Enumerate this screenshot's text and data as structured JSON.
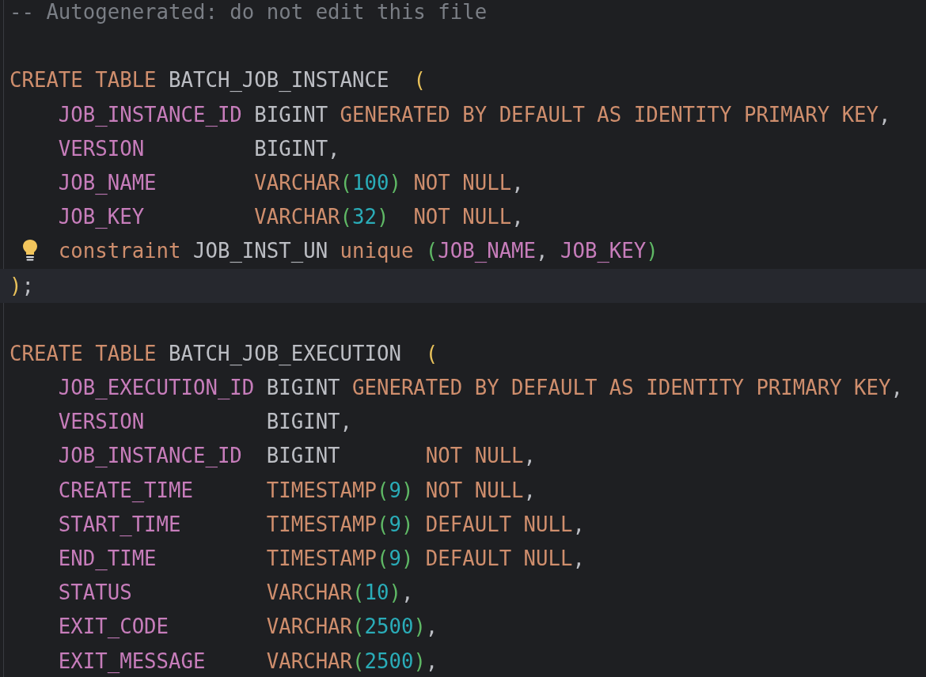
{
  "editor": {
    "lines": [
      {
        "kind": "code",
        "current": false,
        "bulb": false,
        "tokens": [
          {
            "text": "-- Autogenerated: do not edit this file",
            "kind": "comment"
          }
        ]
      },
      {
        "kind": "blank",
        "current": false,
        "bulb": false
      },
      {
        "kind": "code",
        "current": false,
        "bulb": false,
        "tokens": [
          {
            "text": "CREATE TABLE ",
            "kind": "keyword"
          },
          {
            "text": "BATCH_JOB_INSTANCE  ",
            "kind": "plain"
          },
          {
            "text": "(",
            "kind": "paren"
          }
        ],
        "children": [
          {
            "kind": "code",
            "current": false,
            "bulb": false,
            "tokens": [
              {
                "text": "JOB_INSTANCE_ID ",
                "kind": "column"
              },
              {
                "text": "BIGINT ",
                "kind": "plain"
              },
              {
                "text": "GENERATED BY DEFAULT AS IDENTITY PRIMARY KEY",
                "kind": "keyword"
              },
              {
                "text": ",",
                "kind": "plain"
              }
            ]
          },
          {
            "kind": "code",
            "current": false,
            "bulb": false,
            "tokens": [
              {
                "text": "VERSION         ",
                "kind": "column"
              },
              {
                "text": "BIGINT,",
                "kind": "plain"
              }
            ]
          },
          {
            "kind": "code",
            "current": false,
            "bulb": false,
            "tokens": [
              {
                "text": "JOB_NAME        ",
                "kind": "column"
              },
              {
                "text": "VARCHAR",
                "kind": "keyword"
              },
              {
                "text": "(",
                "kind": "inner-paren"
              },
              {
                "text": "100",
                "kind": "number"
              },
              {
                "text": ") ",
                "kind": "inner-paren"
              },
              {
                "text": "NOT NULL",
                "kind": "keyword"
              },
              {
                "text": ",",
                "kind": "plain"
              }
            ]
          },
          {
            "kind": "code",
            "current": false,
            "bulb": false,
            "tokens": [
              {
                "text": "JOB_KEY         ",
                "kind": "column"
              },
              {
                "text": "VARCHAR",
                "kind": "keyword"
              },
              {
                "text": "(",
                "kind": "inner-paren"
              },
              {
                "text": "32",
                "kind": "number"
              },
              {
                "text": ")  ",
                "kind": "inner-paren"
              },
              {
                "text": "NOT NULL",
                "kind": "keyword"
              },
              {
                "text": ",",
                "kind": "plain"
              }
            ]
          },
          {
            "kind": "code",
            "current": false,
            "bulb": true,
            "tokens": [
              {
                "text": "constraint ",
                "kind": "keyword"
              },
              {
                "text": "JOB_INST_UN ",
                "kind": "plain"
              },
              {
                "text": "unique ",
                "kind": "keyword"
              },
              {
                "text": "(",
                "kind": "inner-paren"
              },
              {
                "text": "JOB_NAME",
                "kind": "column"
              },
              {
                "text": ", ",
                "kind": "plain"
              },
              {
                "text": "JOB_KEY",
                "kind": "column"
              },
              {
                "text": ")",
                "kind": "inner-paren"
              }
            ]
          }
        ]
      },
      {
        "kind": "code",
        "current": true,
        "bulb": false,
        "tokens": [
          {
            "text": ")",
            "kind": "paren"
          },
          {
            "text": ";",
            "kind": "plain"
          }
        ]
      },
      {
        "kind": "blank",
        "current": false,
        "bulb": false
      },
      {
        "kind": "code",
        "current": false,
        "bulb": false,
        "tokens": [
          {
            "text": "CREATE TABLE ",
            "kind": "keyword"
          },
          {
            "text": "BATCH_JOB_EXECUTION  ",
            "kind": "plain"
          },
          {
            "text": "(",
            "kind": "paren"
          }
        ],
        "children": [
          {
            "kind": "code",
            "current": false,
            "bulb": false,
            "tokens": [
              {
                "text": "JOB_EXECUTION_ID ",
                "kind": "column"
              },
              {
                "text": "BIGINT ",
                "kind": "plain"
              },
              {
                "text": "GENERATED BY DEFAULT AS IDENTITY PRIMARY KEY",
                "kind": "keyword"
              },
              {
                "text": ",",
                "kind": "plain"
              }
            ]
          },
          {
            "kind": "code",
            "current": false,
            "bulb": false,
            "tokens": [
              {
                "text": "VERSION          ",
                "kind": "column"
              },
              {
                "text": "BIGINT,",
                "kind": "plain"
              }
            ]
          },
          {
            "kind": "code",
            "current": false,
            "bulb": false,
            "tokens": [
              {
                "text": "JOB_INSTANCE_ID  ",
                "kind": "column"
              },
              {
                "text": "BIGINT       ",
                "kind": "plain"
              },
              {
                "text": "NOT NULL",
                "kind": "keyword"
              },
              {
                "text": ",",
                "kind": "plain"
              }
            ]
          },
          {
            "kind": "code",
            "current": false,
            "bulb": false,
            "tokens": [
              {
                "text": "CREATE_TIME      ",
                "kind": "column"
              },
              {
                "text": "TIMESTAMP",
                "kind": "keyword"
              },
              {
                "text": "(",
                "kind": "inner-paren"
              },
              {
                "text": "9",
                "kind": "number"
              },
              {
                "text": ") ",
                "kind": "inner-paren"
              },
              {
                "text": "NOT NULL",
                "kind": "keyword"
              },
              {
                "text": ",",
                "kind": "plain"
              }
            ]
          },
          {
            "kind": "code",
            "current": false,
            "bulb": false,
            "tokens": [
              {
                "text": "START_TIME       ",
                "kind": "column"
              },
              {
                "text": "TIMESTAMP",
                "kind": "keyword"
              },
              {
                "text": "(",
                "kind": "inner-paren"
              },
              {
                "text": "9",
                "kind": "number"
              },
              {
                "text": ") ",
                "kind": "inner-paren"
              },
              {
                "text": "DEFAULT NULL",
                "kind": "keyword"
              },
              {
                "text": ",",
                "kind": "plain"
              }
            ]
          },
          {
            "kind": "code",
            "current": false,
            "bulb": false,
            "tokens": [
              {
                "text": "END_TIME         ",
                "kind": "column"
              },
              {
                "text": "TIMESTAMP",
                "kind": "keyword"
              },
              {
                "text": "(",
                "kind": "inner-paren"
              },
              {
                "text": "9",
                "kind": "number"
              },
              {
                "text": ") ",
                "kind": "inner-paren"
              },
              {
                "text": "DEFAULT NULL",
                "kind": "keyword"
              },
              {
                "text": ",",
                "kind": "plain"
              }
            ]
          },
          {
            "kind": "code",
            "current": false,
            "bulb": false,
            "tokens": [
              {
                "text": "STATUS           ",
                "kind": "column"
              },
              {
                "text": "VARCHAR",
                "kind": "keyword"
              },
              {
                "text": "(",
                "kind": "inner-paren"
              },
              {
                "text": "10",
                "kind": "number"
              },
              {
                "text": ")",
                "kind": "inner-paren"
              },
              {
                "text": ",",
                "kind": "plain"
              }
            ]
          },
          {
            "kind": "code",
            "current": false,
            "bulb": false,
            "tokens": [
              {
                "text": "EXIT_CODE        ",
                "kind": "column"
              },
              {
                "text": "VARCHAR",
                "kind": "keyword"
              },
              {
                "text": "(",
                "kind": "inner-paren"
              },
              {
                "text": "2500",
                "kind": "number"
              },
              {
                "text": ")",
                "kind": "inner-paren"
              },
              {
                "text": ",",
                "kind": "plain"
              }
            ]
          },
          {
            "kind": "code",
            "current": false,
            "bulb": false,
            "tokens": [
              {
                "text": "EXIT_MESSAGE     ",
                "kind": "column"
              },
              {
                "text": "VARCHAR",
                "kind": "keyword"
              },
              {
                "text": "(",
                "kind": "inner-paren"
              },
              {
                "text": "2500",
                "kind": "number"
              },
              {
                "text": ")",
                "kind": "inner-paren"
              },
              {
                "text": ",",
                "kind": "plain"
              }
            ]
          }
        ]
      }
    ]
  }
}
